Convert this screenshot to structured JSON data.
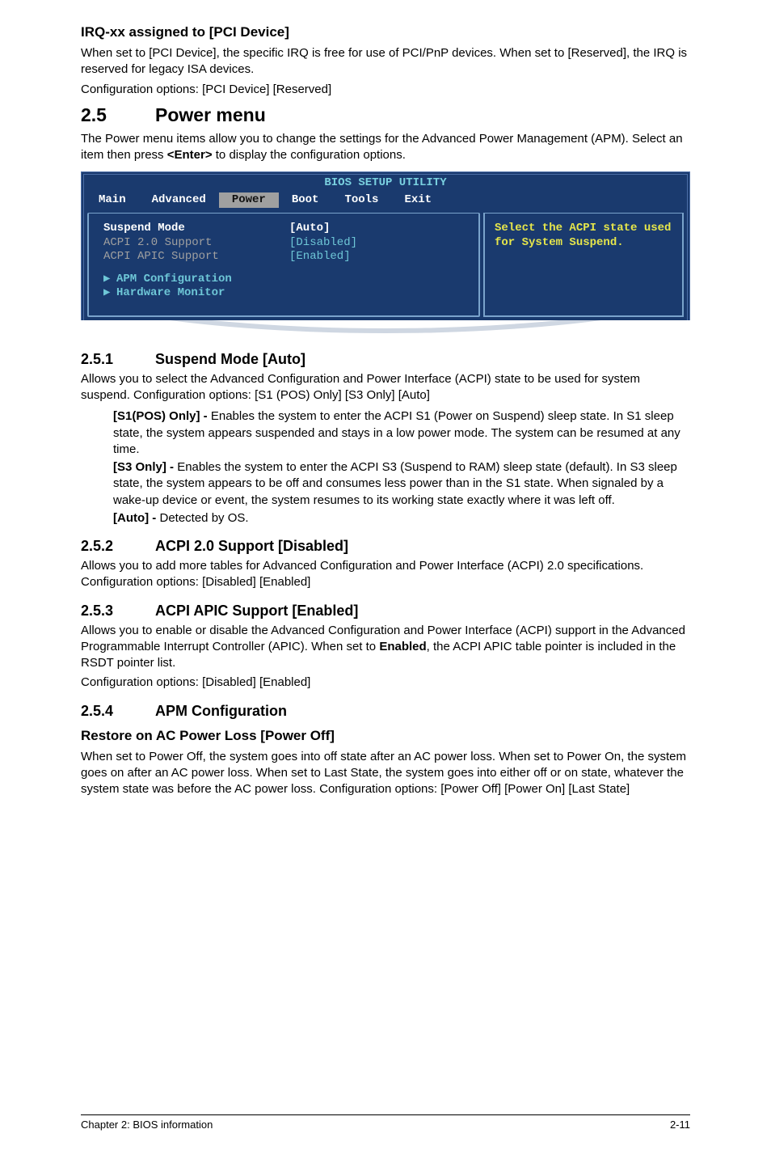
{
  "sec_irq": {
    "heading": "IRQ-xx assigned to [PCI Device]",
    "p1": "When set to [PCI Device], the specific IRQ is free for use of PCI/PnP devices. When set to [Reserved], the IRQ is reserved for legacy ISA devices.",
    "p2": "Configuration options: [PCI Device] [Reserved]"
  },
  "sec25": {
    "num": "2.5",
    "title": "Power menu",
    "intro1": "The Power menu items allow you to change the settings for the Advanced Power Management (APM). Select an item then press ",
    "intro_key": "<Enter>",
    "intro2": " to display the configuration options."
  },
  "bios": {
    "title": "BIOS SETUP UTILITY",
    "tabs": {
      "main": "Main",
      "advanced": "Advanced",
      "power": "Power",
      "boot": "Boot",
      "tools": "Tools",
      "exit": "Exit"
    },
    "rows": {
      "suspend_label": "Suspend Mode",
      "suspend_value": "[Auto]",
      "acpi20_label": "ACPI 2.0 Support",
      "acpi20_value": "[Disabled]",
      "apic_label": "ACPI APIC Support",
      "apic_value": "[Enabled]"
    },
    "subs": {
      "apm": "APM Configuration",
      "hw": "Hardware Monitor"
    },
    "help": "Select the ACPI state used for System Suspend."
  },
  "s251": {
    "num": "2.5.1",
    "title": "Suspend Mode [Auto]",
    "p": "Allows you to select the Advanced Configuration and Power Interface (ACPI) state to be used for system suspend. Configuration options: [S1 (POS) Only] [S3 Only] [Auto]",
    "s1_b": "[S1(POS) Only] - ",
    "s1_t": "Enables the system to enter the ACPI S1 (Power on Suspend) sleep state. In S1 sleep state, the system appears suspended and stays in a low power mode. The system can be resumed at any time.",
    "s3_b": "[S3 Only] - ",
    "s3_t": "Enables the system to enter the ACPI S3 (Suspend to RAM) sleep state (default). In S3 sleep state, the system appears to be off and consumes less power than in the S1 state. When signaled by a wake-up device or event, the system resumes to its working state exactly where it was left off.",
    "auto_b": "[Auto] - ",
    "auto_t": "Detected by OS."
  },
  "s252": {
    "num": "2.5.2",
    "title": "ACPI 2.0 Support [Disabled]",
    "p": "Allows you to add more tables for Advanced Configuration and Power Interface (ACPI) 2.0 specifications. Configuration options: [Disabled] [Enabled]"
  },
  "s253": {
    "num": "2.5.3",
    "title": "ACPI APIC Support [Enabled]",
    "p1a": "Allows you to enable or disable the Advanced Configuration and Power Interface (ACPI) support in the Advanced Programmable Interrupt Controller (APIC). When set to ",
    "p1b": "Enabled",
    "p1c": ", the ACPI APIC table pointer is included in the RSDT pointer list.",
    "p2": "Configuration options: [Disabled] [Enabled]"
  },
  "s254": {
    "num": "2.5.4",
    "title": "APM Configuration",
    "restore_h": "Restore on AC Power Loss [Power Off]",
    "restore_p": "When set to Power Off, the system goes into off state after an AC power loss. When set to Power On, the system goes on after an AC power loss. When set to Last State, the system goes into either off or on state, whatever the system state was before the AC power loss. Configuration options: [Power Off] [Power On] [Last State]"
  },
  "footer": {
    "left": "Chapter 2: BIOS information",
    "right": "2-11"
  }
}
